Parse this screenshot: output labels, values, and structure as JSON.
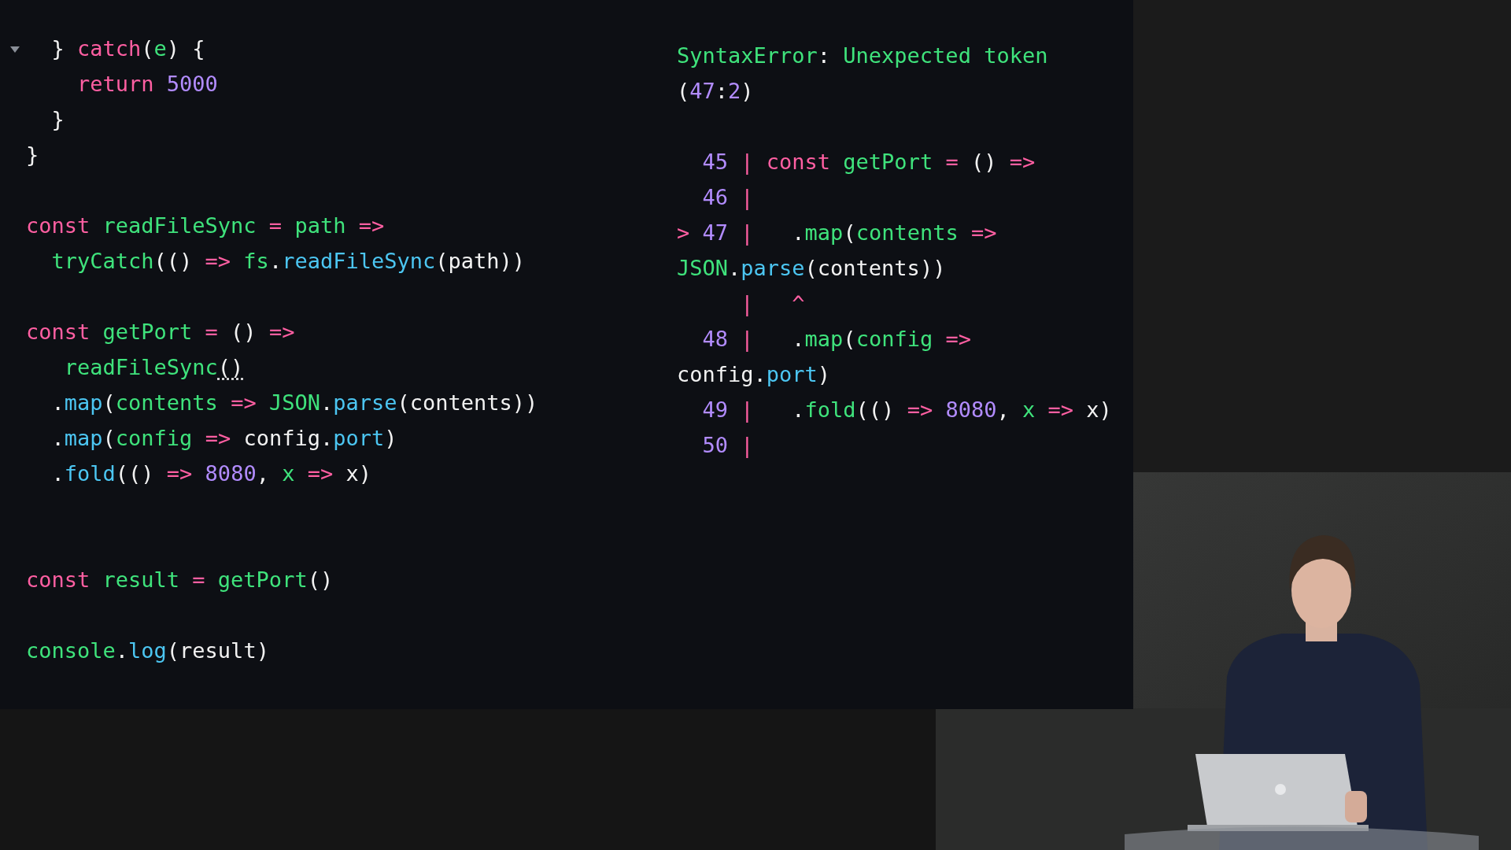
{
  "editor": {
    "lines": [
      {
        "kind": "code",
        "expanded": true,
        "tokens": [
          {
            "text": "  } ",
            "kind": "plain"
          },
          {
            "text": "catch",
            "kind": "kw"
          },
          {
            "text": "(",
            "kind": "plain"
          },
          {
            "text": "e",
            "kind": "id"
          },
          {
            "text": ") {",
            "kind": "plain"
          }
        ]
      },
      {
        "kind": "code",
        "tokens": [
          {
            "text": "    return",
            "kind": "kw"
          },
          {
            "text": " 5000",
            "kind": "num"
          }
        ]
      },
      {
        "kind": "code",
        "tokens": [
          {
            "text": "  }",
            "kind": "plain"
          }
        ]
      },
      {
        "kind": "code",
        "tokens": [
          {
            "text": "}",
            "kind": "plain"
          }
        ]
      },
      {
        "kind": "blank"
      },
      {
        "kind": "code",
        "tokens": [
          {
            "text": "const",
            "kind": "kw"
          },
          {
            "text": " readFileSync",
            "kind": "id"
          },
          {
            "text": " =",
            "kind": "kw"
          },
          {
            "text": " path",
            "kind": "id"
          },
          {
            "text": " =>",
            "kind": "kw"
          }
        ]
      },
      {
        "kind": "code",
        "tokens": [
          {
            "text": "  tryCatch",
            "kind": "id"
          },
          {
            "text": "(() ",
            "kind": "plain"
          },
          {
            "text": "=>",
            "kind": "kw"
          },
          {
            "text": " fs",
            "kind": "id"
          },
          {
            "text": ".",
            "kind": "plain"
          },
          {
            "text": "readFileSync",
            "kind": "fn"
          },
          {
            "text": "(path))",
            "kind": "plain"
          }
        ]
      },
      {
        "kind": "blank"
      },
      {
        "kind": "code",
        "tokens": [
          {
            "text": "const",
            "kind": "kw"
          },
          {
            "text": " getPort",
            "kind": "id"
          },
          {
            "text": " =",
            "kind": "kw"
          },
          {
            "text": " () ",
            "kind": "plain"
          },
          {
            "text": "=>",
            "kind": "kw"
          }
        ]
      },
      {
        "kind": "code",
        "tokens": [
          {
            "text": "   readFileSync",
            "kind": "id"
          },
          {
            "text": "()",
            "kind": "plain",
            "underlined": true
          }
        ]
      },
      {
        "kind": "code",
        "tokens": [
          {
            "text": "  .",
            "kind": "plain"
          },
          {
            "text": "map",
            "kind": "fn"
          },
          {
            "text": "(",
            "kind": "plain"
          },
          {
            "text": "contents",
            "kind": "id"
          },
          {
            "text": " =>",
            "kind": "kw"
          },
          {
            "text": " JSON",
            "kind": "id"
          },
          {
            "text": ".",
            "kind": "plain"
          },
          {
            "text": "parse",
            "kind": "fn"
          },
          {
            "text": "(contents))",
            "kind": "plain"
          }
        ]
      },
      {
        "kind": "code",
        "tokens": [
          {
            "text": "  .",
            "kind": "plain"
          },
          {
            "text": "map",
            "kind": "fn"
          },
          {
            "text": "(",
            "kind": "plain"
          },
          {
            "text": "config",
            "kind": "id"
          },
          {
            "text": " =>",
            "kind": "kw"
          },
          {
            "text": " config.",
            "kind": "plain"
          },
          {
            "text": "port",
            "kind": "fn"
          },
          {
            "text": ")",
            "kind": "plain"
          }
        ]
      },
      {
        "kind": "code",
        "tokens": [
          {
            "text": "  .",
            "kind": "plain"
          },
          {
            "text": "fold",
            "kind": "fn"
          },
          {
            "text": "(() ",
            "kind": "plain"
          },
          {
            "text": "=>",
            "kind": "kw"
          },
          {
            "text": " 8080",
            "kind": "num"
          },
          {
            "text": ", ",
            "kind": "plain"
          },
          {
            "text": "x",
            "kind": "id"
          },
          {
            "text": " =>",
            "kind": "kw"
          },
          {
            "text": " x)",
            "kind": "plain"
          }
        ]
      },
      {
        "kind": "blank"
      },
      {
        "kind": "blank"
      },
      {
        "kind": "code",
        "tokens": [
          {
            "text": "const",
            "kind": "kw"
          },
          {
            "text": " result",
            "kind": "id"
          },
          {
            "text": " =",
            "kind": "kw"
          },
          {
            "text": " getPort",
            "kind": "id"
          },
          {
            "text": "()",
            "kind": "plain"
          }
        ]
      },
      {
        "kind": "blank"
      },
      {
        "kind": "code",
        "tokens": [
          {
            "text": "console",
            "kind": "id"
          },
          {
            "text": ".",
            "kind": "plain"
          },
          {
            "text": "log",
            "kind": "fn"
          },
          {
            "text": "(result)",
            "kind": "plain"
          }
        ]
      }
    ]
  },
  "error_output": {
    "lines": [
      {
        "kind": "code",
        "tokens": [
          {
            "text": "SyntaxError",
            "kind": "id"
          },
          {
            "text": ": ",
            "kind": "plain"
          },
          {
            "text": "Unexpected token",
            "kind": "id"
          }
        ]
      },
      {
        "kind": "code",
        "tokens": [
          {
            "text": "(",
            "kind": "plain"
          },
          {
            "text": "47",
            "kind": "num"
          },
          {
            "text": ":",
            "kind": "plain"
          },
          {
            "text": "2",
            "kind": "num"
          },
          {
            "text": ")",
            "kind": "plain"
          }
        ]
      },
      {
        "kind": "blank"
      },
      {
        "kind": "code",
        "tokens": [
          {
            "text": "  45",
            "kind": "num"
          },
          {
            "text": " |",
            "kind": "kw"
          },
          {
            "text": " const",
            "kind": "kw"
          },
          {
            "text": " getPort",
            "kind": "id"
          },
          {
            "text": " =",
            "kind": "kw"
          },
          {
            "text": " () ",
            "kind": "plain"
          },
          {
            "text": "=>",
            "kind": "kw"
          }
        ]
      },
      {
        "kind": "code",
        "tokens": [
          {
            "text": "  46",
            "kind": "num"
          },
          {
            "text": " |",
            "kind": "kw"
          }
        ]
      },
      {
        "kind": "code",
        "tokens": [
          {
            "text": ">",
            "kind": "kw"
          },
          {
            "text": " 47",
            "kind": "num"
          },
          {
            "text": " |",
            "kind": "kw"
          },
          {
            "text": "   .",
            "kind": "plain"
          },
          {
            "text": "map",
            "kind": "id"
          },
          {
            "text": "(",
            "kind": "plain"
          },
          {
            "text": "contents",
            "kind": "id"
          },
          {
            "text": " =>",
            "kind": "kw"
          }
        ]
      },
      {
        "kind": "code",
        "tokens": [
          {
            "text": "JSON",
            "kind": "id"
          },
          {
            "text": ".",
            "kind": "plain"
          },
          {
            "text": "parse",
            "kind": "fn"
          },
          {
            "text": "(contents))",
            "kind": "plain"
          }
        ]
      },
      {
        "kind": "code",
        "tokens": [
          {
            "text": "     |",
            "kind": "kw"
          },
          {
            "text": "   ^",
            "kind": "kw"
          }
        ]
      },
      {
        "kind": "code",
        "tokens": [
          {
            "text": "  48",
            "kind": "num"
          },
          {
            "text": " |",
            "kind": "kw"
          },
          {
            "text": "   .",
            "kind": "plain"
          },
          {
            "text": "map",
            "kind": "id"
          },
          {
            "text": "(",
            "kind": "plain"
          },
          {
            "text": "config",
            "kind": "id"
          },
          {
            "text": " =>",
            "kind": "kw"
          }
        ]
      },
      {
        "kind": "code",
        "tokens": [
          {
            "text": "config.",
            "kind": "plain"
          },
          {
            "text": "port",
            "kind": "fn"
          },
          {
            "text": ")",
            "kind": "plain"
          }
        ]
      },
      {
        "kind": "code",
        "tokens": [
          {
            "text": "  49",
            "kind": "num"
          },
          {
            "text": " |",
            "kind": "kw"
          },
          {
            "text": "   .",
            "kind": "plain"
          },
          {
            "text": "fold",
            "kind": "id"
          },
          {
            "text": "(() ",
            "kind": "plain"
          },
          {
            "text": "=>",
            "kind": "kw"
          },
          {
            "text": " 8080",
            "kind": "num"
          },
          {
            "text": ", ",
            "kind": "plain"
          },
          {
            "text": "x",
            "kind": "id"
          },
          {
            "text": " =>",
            "kind": "kw"
          },
          {
            "text": " x)",
            "kind": "plain"
          }
        ]
      },
      {
        "kind": "code",
        "tokens": [
          {
            "text": "  50",
            "kind": "num"
          },
          {
            "text": " |",
            "kind": "kw"
          }
        ]
      }
    ]
  }
}
